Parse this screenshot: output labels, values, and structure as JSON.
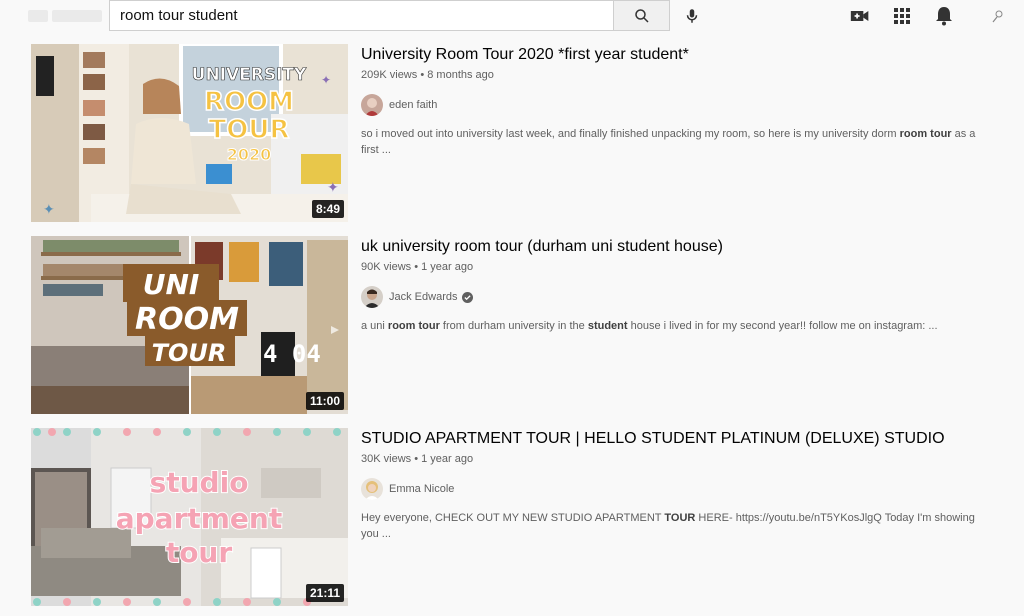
{
  "search": {
    "query": "room tour student"
  },
  "icons": {
    "search": "search-icon",
    "mic": "microphone-icon",
    "create": "video-camera-plus-icon",
    "apps": "apps-grid-icon",
    "notifications": "bell-icon",
    "account": "account-icon"
  },
  "results": [
    {
      "title": "University Room Tour 2020 *first year student*",
      "views": "209K views",
      "age": "8 months ago",
      "channel": "eden faith",
      "verified": false,
      "duration": "8:49",
      "thumb_text": [
        "UNIVERSITY",
        "ROOM",
        "TOUR",
        "2020"
      ],
      "description": [
        {
          "t": "so i moved out into university last week, and finally finished unpacking my room, so here is my university dorm ",
          "b": false
        },
        {
          "t": "room tour",
          "b": true
        },
        {
          "t": " as a first ...",
          "b": false
        }
      ]
    },
    {
      "title": "uk university room tour (durham uni student house)",
      "views": "90K views",
      "age": "1 year ago",
      "channel": "Jack Edwards",
      "verified": true,
      "duration": "11:00",
      "thumb_text": [
        "UNI",
        "ROOM",
        "TOUR",
        "4 04"
      ],
      "description": [
        {
          "t": "a uni ",
          "b": false
        },
        {
          "t": "room tour",
          "b": true
        },
        {
          "t": " from durham university in the ",
          "b": false
        },
        {
          "t": "student",
          "b": true
        },
        {
          "t": " house i lived in for my second year!! follow me on instagram: ...",
          "b": false
        }
      ]
    },
    {
      "title": "STUDIO APARTMENT TOUR | HELLO STUDENT PLATINUM (DELUXE) STUDIO",
      "views": "30K views",
      "age": "1 year ago",
      "channel": "Emma Nicole",
      "verified": false,
      "duration": "21:11",
      "thumb_text": [
        "studio",
        "apartment",
        "tour"
      ],
      "description": [
        {
          "t": "Hey everyone, CHECK OUT MY NEW STUDIO APARTMENT ",
          "b": false
        },
        {
          "t": "TOUR",
          "b": true
        },
        {
          "t": " HERE- https://youtu.be/nT5YKosJlgQ Today I'm showing you ...",
          "b": false
        }
      ]
    }
  ],
  "colors": {
    "background": "#f9f9f9",
    "title": "#030303",
    "meta": "#606060"
  }
}
